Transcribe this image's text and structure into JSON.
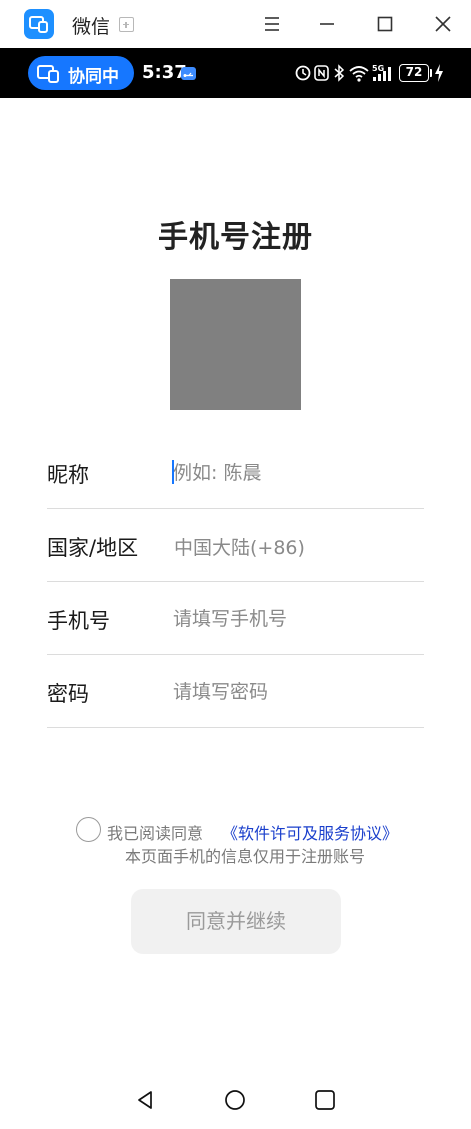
{
  "window": {
    "app_title": "微信",
    "logo_icon": "multi-device-icon",
    "menu_icon": "menu-icon",
    "minimize_icon": "minimize-icon",
    "maximize_icon": "maximize-icon",
    "close_icon": "close-icon"
  },
  "status_bar": {
    "sync_label": "协同中",
    "time": "5:37",
    "battery_level": "72",
    "icons": [
      "usb-icon",
      "alarm-icon",
      "nfc-icon",
      "bluetooth-icon",
      "wifi-icon",
      "5g-signal-icon",
      "battery-icon",
      "charging-icon"
    ]
  },
  "form": {
    "title": "手机号注册",
    "nickname_label": "昵称",
    "nickname_placeholder": "例如: 陈晨",
    "region_label": "国家/地区",
    "region_value": "中国大陆(+86)",
    "phone_label": "手机号",
    "phone_placeholder": "请填写手机号",
    "password_label": "密码",
    "password_placeholder": "请填写密码"
  },
  "agreement": {
    "text": "我已阅读同意",
    "link": "《软件许可及服务协议》",
    "note": "本页面手机的信息仅用于注册账号",
    "checked": false
  },
  "submit": {
    "label": "同意并继续"
  },
  "navbar": {
    "icons": [
      "back-icon",
      "home-icon",
      "recents-icon"
    ]
  },
  "colors": {
    "accent": "#1677ff",
    "link": "#1a3fcc",
    "button_bg": "#f1f1f1",
    "button_text": "#9a9a9a",
    "avatar": "#808080"
  }
}
